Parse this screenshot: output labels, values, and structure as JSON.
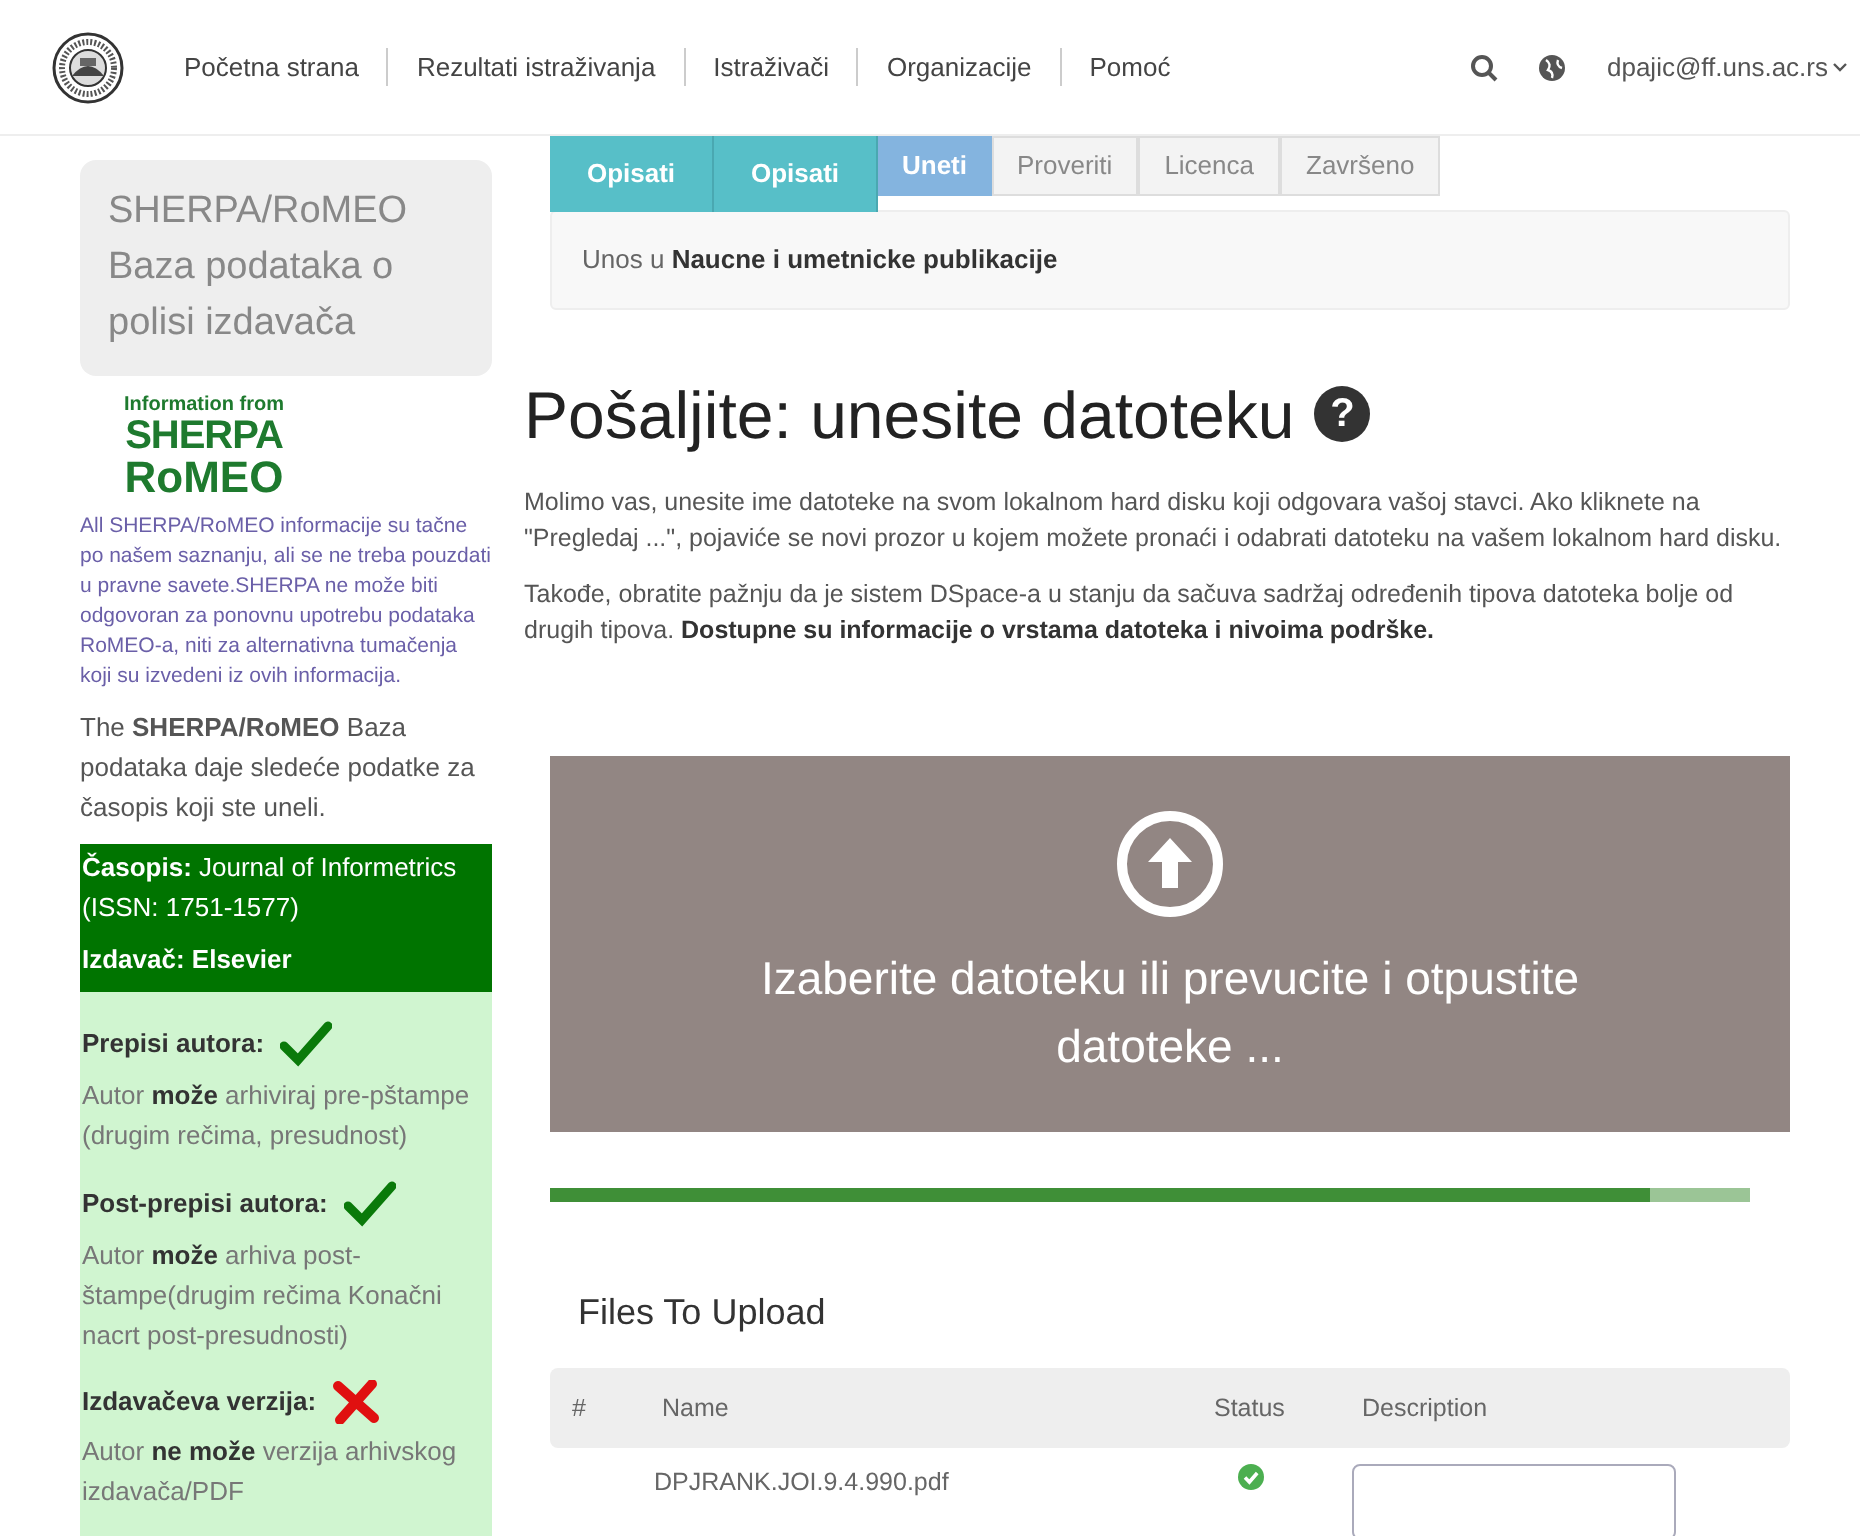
{
  "nav": {
    "items": [
      "Početna strana",
      "Rezultati istraživanja",
      "Istraživači",
      "Organizacije",
      "Pomoć"
    ],
    "user": "dpajic@ff.uns.ac.rs"
  },
  "sidebar": {
    "title": "SHERPA/RoMEO Baza podataka o polisi izdavača",
    "logo": {
      "top": "Information from",
      "line_1": "SHERPA",
      "line_2": "RoMEO"
    },
    "disclaimer": "All SHERPA/RoMEO informacije su tačne po našem saznanju, ali se ne treba pouzdati u pravne savete.SHERPA ne može biti odgovoran za ponovnu upotrebu podataka RoMEO-a, niti za alternativna tumačenja koji su izvedeni iz ovih informacija.",
    "intro": "The **SHERPA/RoMEO** Baza podataka daje sledeće podatke za časopis koji ste uneli.",
    "journal": "**Časopis:** Journal of Informetrics (ISSN: 1751-1577)",
    "publisher": "Izdavač: Elsevier",
    "policies": [
      {
        "label": "Prepisi autora:",
        "kind": "allowed",
        "text": "Autor **može** arhiviraj pre-pštampe (drugim rečima, presudnost)"
      },
      {
        "label": "Post-prepisi autora:",
        "kind": "allowed",
        "text": "Autor **može** arhiva post-štampe(drugim rečima Konačni nacrt post-presudnosti)"
      },
      {
        "label": "Izdavačeva verzija:",
        "kind": "forbidden",
        "text": "Autor **ne može** verzija arhivskog izdavača/PDF"
      }
    ]
  },
  "steps": [
    {
      "label": "Opisati",
      "selected": false,
      "completed": true
    },
    {
      "label": "Opisati",
      "selected": false,
      "completed": true
    },
    {
      "label": "Uneti",
      "selected": true,
      "completed": false
    },
    {
      "label": "Proveriti",
      "selected": false,
      "completed": false
    },
    {
      "label": "Licenca",
      "selected": false,
      "completed": false
    },
    {
      "label": "Završeno",
      "selected": false,
      "completed": false
    }
  ],
  "collection": "Unos u **Naucne i umetnicke publikacije**",
  "heading": "Pošaljite: unesite datoteku",
  "help_icon": "?",
  "paragraphs": [
    "Molimo vas, unesite ime datoteke na svom lokalnom hard disku koji odgovara vašoj stavci. Ako kliknete na \"Pregledaj ...\", pojaviće se novi prozor u kojem možete pronaći i odabrati datoteku na vašem lokalnom hard disku.",
    "Takođe, obratite pažnju da je sistem DSpace-a u stanju da sačuva sadržaj određenih tipova datoteka bolje od drugih tipova. **Dostupne su informacije o vrstama datoteka i nivoima podrške.**"
  ],
  "dropzone": {
    "text": "Izaberite datoteku ili prevucite i otpustite datoteke ..."
  },
  "progress": {
    "level": 0.917
  },
  "files": {
    "title": "Files To Upload",
    "columns": [
      "#",
      "Name",
      "Status",
      "Description"
    ],
    "rows": [
      {
        "name": "DPJRANK.JOI.9.4.990.pdf",
        "uploaded": true
      }
    ]
  }
}
